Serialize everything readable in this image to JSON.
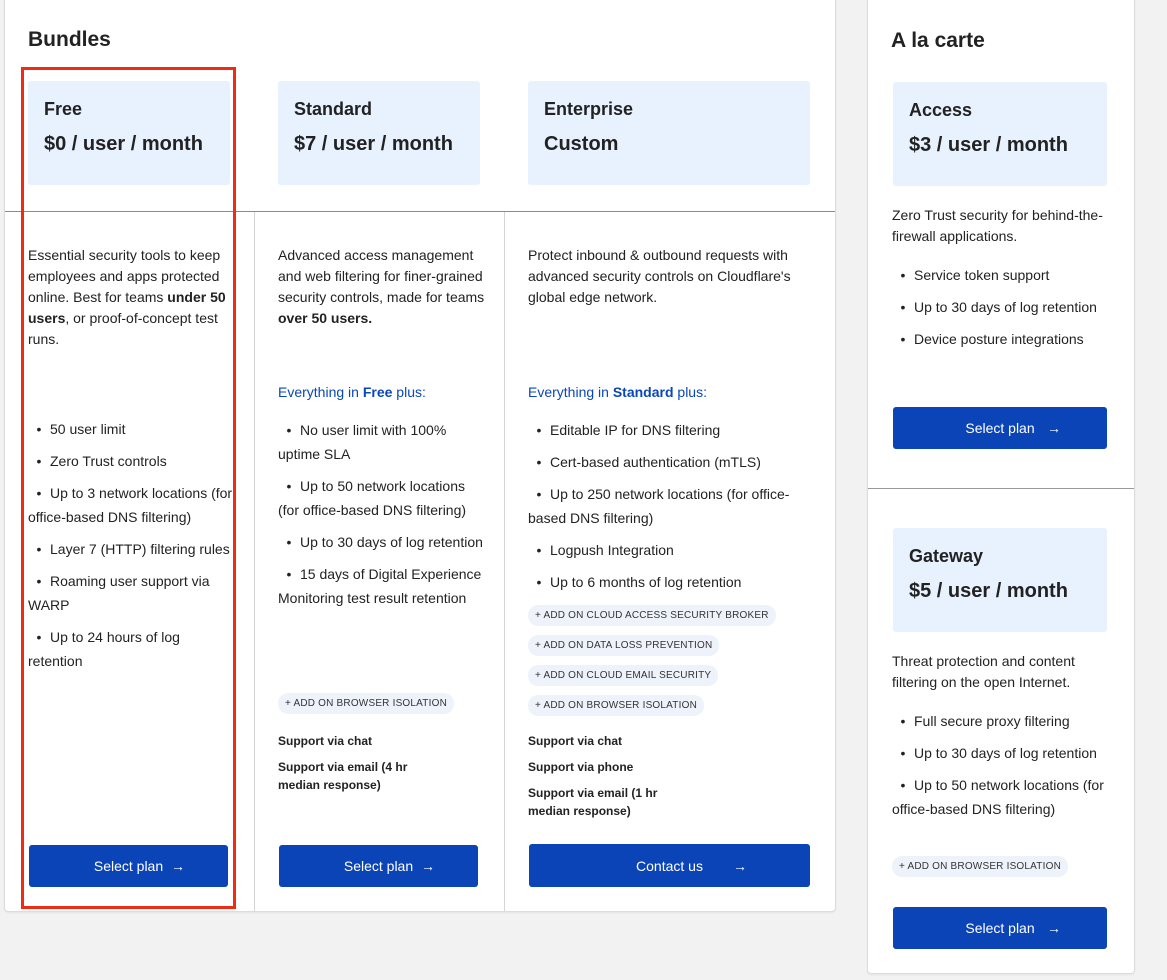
{
  "bundles": {
    "title": "Bundles",
    "plans": [
      {
        "name": "Free",
        "price": "$0 / user / month",
        "desc_parts": [
          "Essential security tools to keep employees and apps protected online. Best for teams ",
          "under 50 users",
          ", or proof-of-concept test runs."
        ],
        "features": [
          "50 user limit",
          "Zero Trust controls",
          "Up to 3 network locations (for office-based DNS filtering)",
          "Layer 7 (HTTP) filtering rules",
          "Roaming user support via WARP",
          "Up to 24 hours of log retention"
        ],
        "button": "Select plan"
      },
      {
        "name": "Standard",
        "price": "$7 / user / month",
        "desc_parts": [
          "Advanced access management and web filtering for finer-grained security controls, made for teams ",
          "over 50 users."
        ],
        "plus_prefix": "Everything in ",
        "plus_plan": "Free",
        "plus_suffix": " plus:",
        "features": [
          "No user limit with 100% uptime SLA",
          "Up to 50 network locations (for office-based DNS filtering)",
          "Up to 30 days of log retention",
          "15 days of Digital Experience Monitoring test result retention"
        ],
        "addons": [
          "+ ADD ON BROWSER ISOLATION"
        ],
        "support": [
          "Support via chat",
          "Support via email (4 hr median response)"
        ],
        "button": "Select plan"
      },
      {
        "name": "Enterprise",
        "price": "Custom",
        "desc": "Protect inbound & outbound requests with advanced security controls on Cloudflare's global edge network.",
        "plus_prefix": "Everything in ",
        "plus_plan": "Standard",
        "plus_suffix": " plus:",
        "features": [
          "Editable IP for DNS filtering",
          "Cert-based authentication (mTLS)",
          "Up to 250 network locations (for office-based DNS filtering)",
          "Logpush Integration",
          "Up to 6 months of log retention"
        ],
        "addons": [
          "+ ADD ON CLOUD ACCESS SECURITY BROKER",
          "+ ADD ON DATA LOSS PREVENTION",
          "+ ADD ON CLOUD EMAIL SECURITY",
          "+ ADD ON BROWSER ISOLATION"
        ],
        "support": [
          "Support via chat",
          "Support via phone",
          "Support via email (1 hr median response)"
        ],
        "button": "Contact us"
      }
    ]
  },
  "alacarte": {
    "title": "A la carte",
    "plans": [
      {
        "name": "Access",
        "price": "$3 / user / month",
        "desc": "Zero Trust security for behind-the-firewall applications.",
        "features": [
          "Service token support",
          "Up to 30 days of log retention",
          "Device posture integrations"
        ],
        "button": "Select plan"
      },
      {
        "name": "Gateway",
        "price": "$5 / user / month",
        "desc": "Threat protection and content filtering on the open Internet.",
        "features": [
          "Full secure proxy filtering",
          "Up to 30 days of log retention",
          "Up to 50 network locations (for office-based DNS filtering)"
        ],
        "addons": [
          "+ ADD ON BROWSER ISOLATION"
        ],
        "button": "Select plan"
      }
    ]
  },
  "icons": {
    "arrow": "arrow-right-icon",
    "bullet": "bullet-dot-icon"
  },
  "colors": {
    "accent": "#0a44b7",
    "header_bg": "#e8f1fe",
    "highlight": "#ee2c14",
    "link": "#0a47b8"
  }
}
